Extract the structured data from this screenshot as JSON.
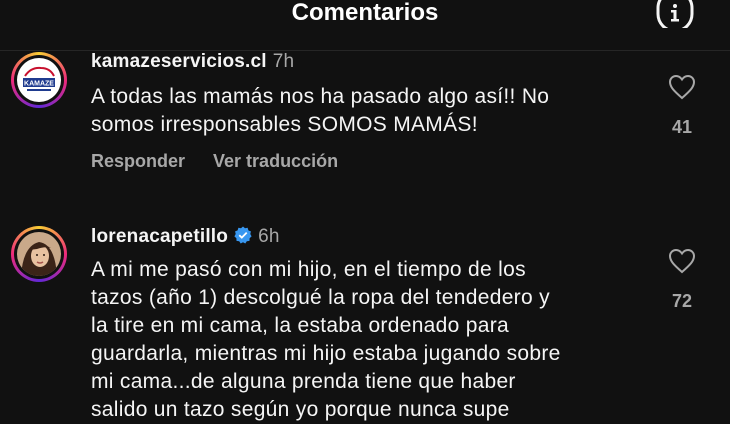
{
  "header": {
    "title": "Comentarios"
  },
  "comments": [
    {
      "username": "kamazeservicios.cl",
      "time": "7h",
      "text": "A todas las mamás nos ha pasado algo así!! No\nsomos irresponsables SOMOS MAMÁS!",
      "reply_label": "Responder",
      "translate_label": "Ver traducción",
      "likes": "41",
      "avatar_text": "KAMAZE"
    },
    {
      "username": "lorenacapetillo",
      "verified": true,
      "time": "6h",
      "text": "A mi me pasó con mi hijo, en el tiempo de los\ntazos (año 1) descolgué la ropa del tendedero y\nla tire en mi cama, la estaba ordenado para\nguardarla, mientras mi hijo estaba jugando sobre\nmi cama...de alguna prenda tiene que haber\nsalido un tazo según yo porque nunca supe",
      "likes": "72"
    }
  ],
  "colors": {
    "background": "#111111",
    "muted": "#a8a8a8",
    "verified": "#3897f0"
  }
}
